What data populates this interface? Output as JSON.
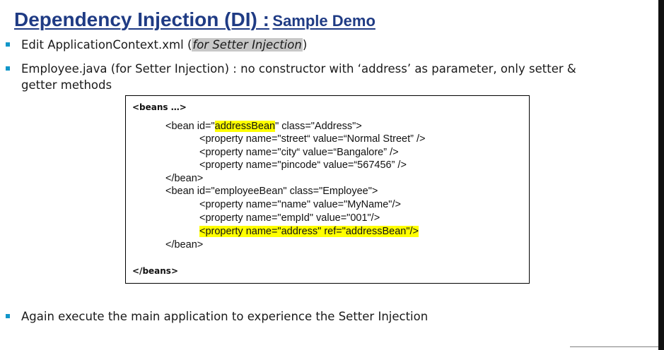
{
  "title": {
    "main": "Dependency Injection (DI) :",
    "sub": "Sample Demo"
  },
  "bullets": [
    {
      "prefix": "Edit ApplicationContext.xml  (",
      "highlight": "for Setter Injection",
      "suffix": ")"
    },
    {
      "text": "Employee.java (for Setter Injection) : no constructor with ‘address’ as parameter, only setter & getter methods"
    },
    {
      "text": "Again execute the main application to experience the Setter Injection"
    }
  ],
  "code": {
    "beans_open": "<beans …>",
    "bean1_prefix": "<bean id=\"",
    "bean1_highlight": "addressBean",
    "bean1_suffix": "\" class=\"Address\">",
    "prop_street": "<property name=\"street“ value=“Normal Street” />",
    "prop_city": "<property name=\"city“ value=“Bangalore” />",
    "prop_pincode": "<property name=\"pincode“ value=“567456” />",
    "bean_close_1": "</bean>",
    "bean2_open": "<bean id=\"employeeBean\" class=\"Employee\">",
    "prop_name": "<property name=\"name\" value=\"MyName\"/>",
    "prop_empid": "<property name=\"empId\" value=\"001\"/>",
    "prop_address": "<property name=\"address\" ref=\"addressBean\"/>",
    "bean_close_2": "</bean>",
    "beans_close": "</beans>"
  },
  "colors": {
    "title": "#1f3b84",
    "bullet": "#1196c9",
    "highlight_yellow": "#ffff00",
    "highlight_grey": "#c8c8c8"
  }
}
